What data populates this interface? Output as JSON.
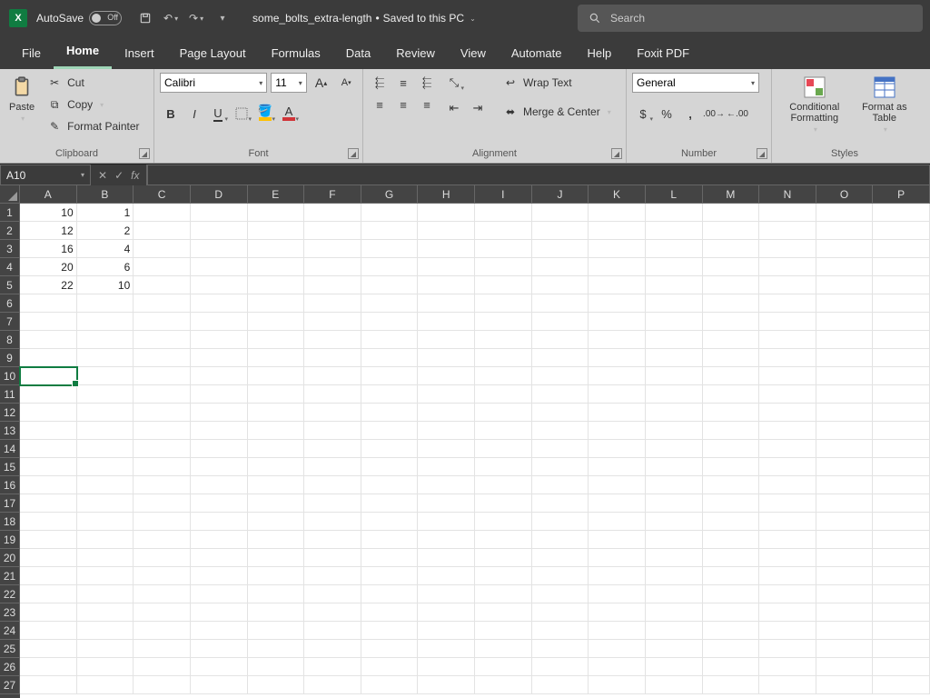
{
  "titlebar": {
    "autosave_label": "AutoSave",
    "autosave_state": "Off",
    "doc_name": "some_bolts_extra-length",
    "save_status": "Saved to this PC",
    "search_placeholder": "Search"
  },
  "tabs": [
    "File",
    "Home",
    "Insert",
    "Page Layout",
    "Formulas",
    "Data",
    "Review",
    "View",
    "Automate",
    "Help",
    "Foxit PDF"
  ],
  "active_tab": "Home",
  "ribbon": {
    "clipboard": {
      "paste": "Paste",
      "cut": "Cut",
      "copy": "Copy",
      "format_painter": "Format Painter",
      "label": "Clipboard"
    },
    "font": {
      "name": "Calibri",
      "size": "11",
      "label": "Font"
    },
    "alignment": {
      "wrap": "Wrap Text",
      "merge": "Merge & Center",
      "label": "Alignment"
    },
    "number": {
      "format": "General",
      "label": "Number"
    },
    "styles": {
      "cond": "Conditional Formatting",
      "table": "Format as Table",
      "label": "Styles"
    }
  },
  "namebox": "A10",
  "formula": "",
  "columns": [
    "A",
    "B",
    "C",
    "D",
    "E",
    "F",
    "G",
    "H",
    "I",
    "J",
    "K",
    "L",
    "M",
    "N",
    "O",
    "P"
  ],
  "row_count": 27,
  "selected": {
    "row": 10,
    "col": 0
  },
  "data": {
    "1": {
      "A": "10",
      "B": "1"
    },
    "2": {
      "A": "12",
      "B": "2"
    },
    "3": {
      "A": "16",
      "B": "4"
    },
    "4": {
      "A": "20",
      "B": "6"
    },
    "5": {
      "A": "22",
      "B": "10"
    }
  }
}
